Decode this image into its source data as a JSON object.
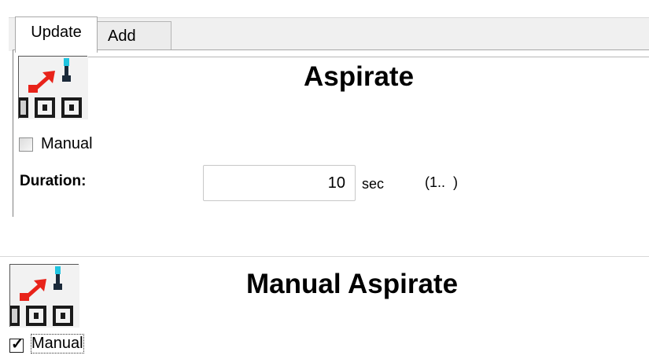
{
  "tabs": [
    {
      "label": "Update",
      "active": true
    },
    {
      "label": "Add",
      "active": false
    }
  ],
  "step": {
    "icon": "aspirate-step-icon",
    "title": "Aspirate",
    "manual_checkbox": {
      "label": "Manual",
      "checked": false
    },
    "duration": {
      "label": "Duration:",
      "value": "10",
      "unit": "sec",
      "range": "(1..  )"
    }
  },
  "manual_step": {
    "icon": "aspirate-step-icon",
    "title": "Manual Aspirate",
    "manual_checkbox": {
      "label": "Manual",
      "checked": true
    }
  },
  "colors": {
    "arrow": "#e8231a",
    "probe_tip": "#20c4e0",
    "probe": "#1b2a3a",
    "icon_bg": "#f2f2f2"
  }
}
